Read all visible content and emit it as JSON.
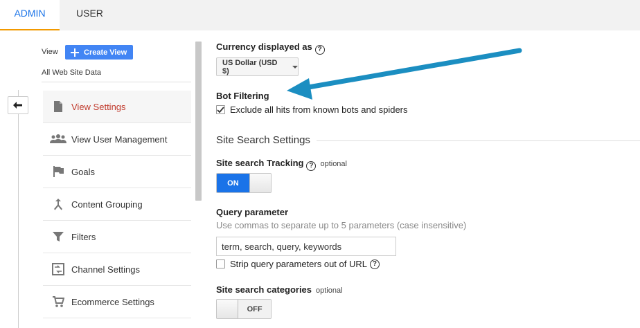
{
  "tabs": {
    "admin": "ADMIN",
    "user": "USER"
  },
  "view_header": {
    "view_label": "View",
    "create_view_label": "Create View",
    "property_name": "All Web Site Data"
  },
  "sidebar": {
    "items": [
      {
        "label": "View Settings",
        "icon": "document-icon",
        "active": true
      },
      {
        "label": "View User Management",
        "icon": "people-icon",
        "active": false
      },
      {
        "label": "Goals",
        "icon": "flag-icon",
        "active": false
      },
      {
        "label": "Content Grouping",
        "icon": "merge-icon",
        "active": false
      },
      {
        "label": "Filters",
        "icon": "funnel-icon",
        "active": false
      },
      {
        "label": "Channel Settings",
        "icon": "channel-icon",
        "active": false
      },
      {
        "label": "Ecommerce Settings",
        "icon": "cart-icon",
        "active": false
      }
    ]
  },
  "settings": {
    "currency_label": "Currency displayed as",
    "currency_value": "US Dollar (USD $)",
    "bot_filtering_label": "Bot Filtering",
    "bot_filtering_checkbox": "Exclude all hits from known bots and spiders",
    "bot_filtering_checked": true,
    "site_search_section": "Site Search Settings",
    "site_search_tracking_label": "Site search Tracking",
    "optional": "optional",
    "tracking_toggle": "ON",
    "query_parameter_label": "Query parameter",
    "query_parameter_hint": "Use commas to separate up to 5 parameters (case insensitive)",
    "query_parameter_value": "term, search, query, keywords",
    "strip_label": "Strip query parameters out of URL",
    "strip_checked": false,
    "site_search_categories_label": "Site search categories",
    "categories_toggle": "OFF"
  },
  "colors": {
    "accent_blue": "#1a73e8",
    "active_tab_underline": "#f29900",
    "annotation_arrow": "#1b8ec1"
  }
}
